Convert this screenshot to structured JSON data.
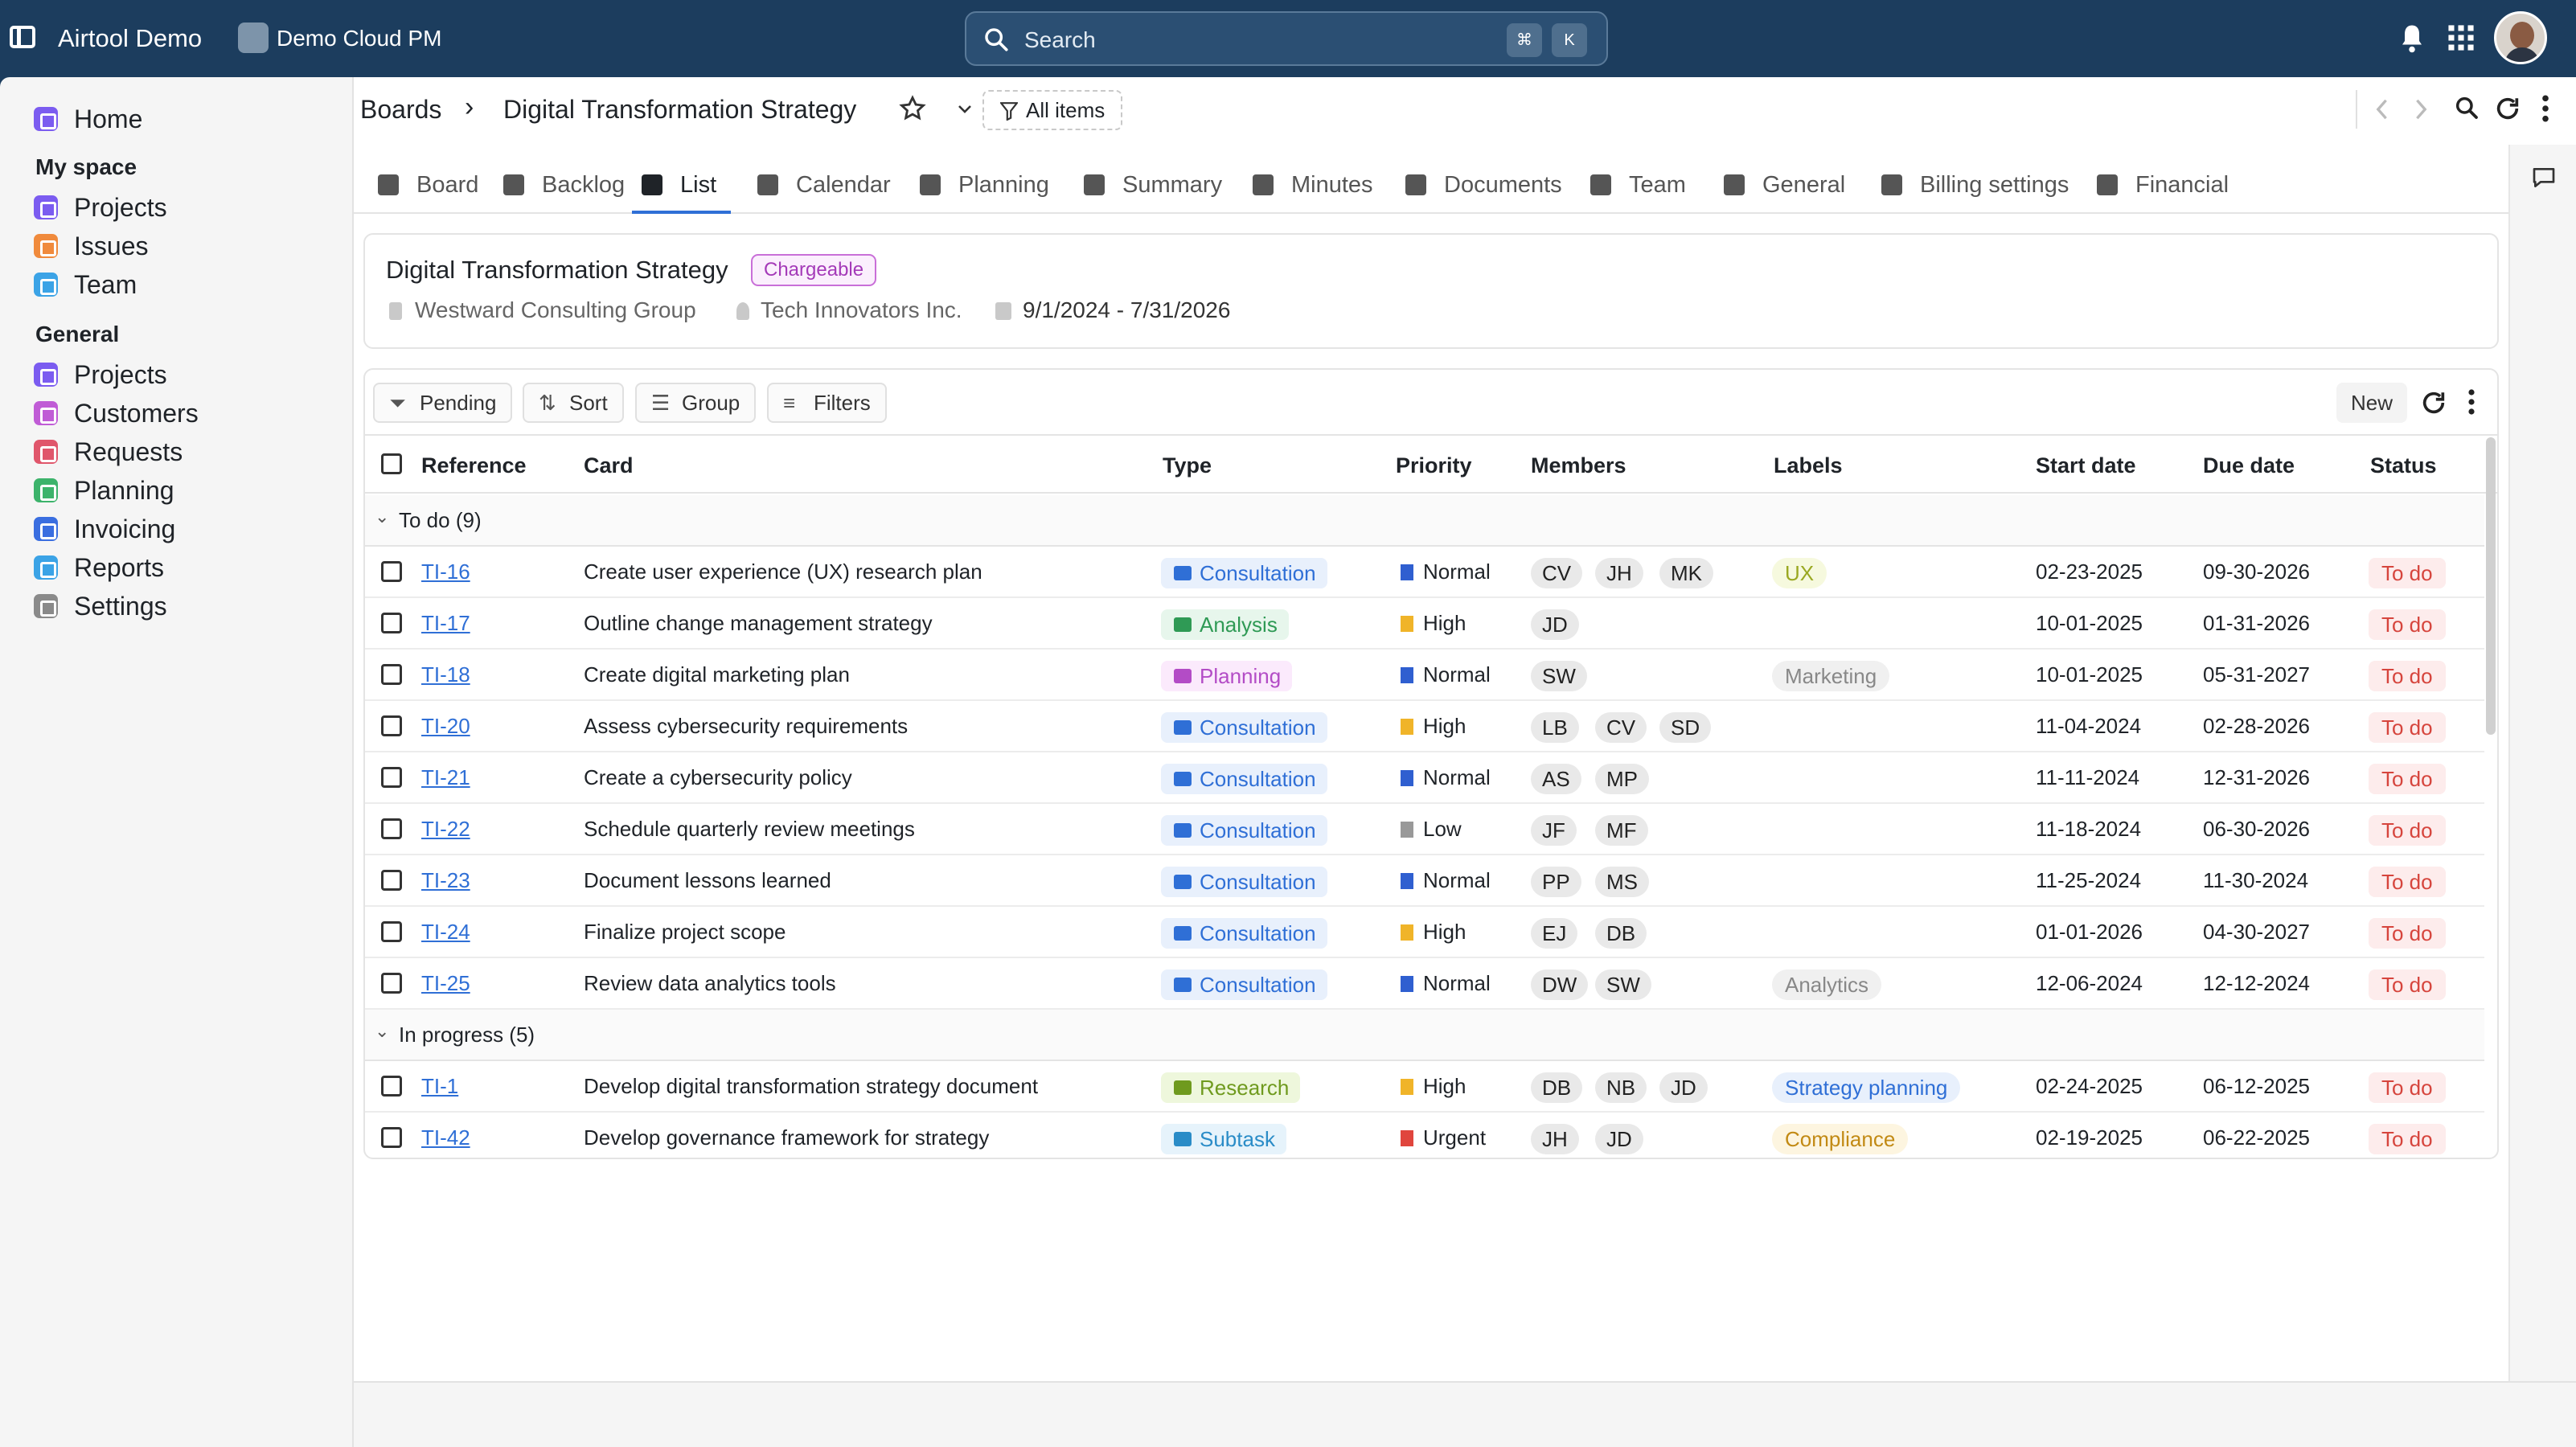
{
  "app": {
    "workspace": "Airtool Demo",
    "project": "Demo Cloud PM",
    "search_placeholder": "Search",
    "kbd1": "⌘",
    "kbd2": "K"
  },
  "sidebar": {
    "home": "Home",
    "my_space_heading": "My space",
    "my_space": [
      {
        "label": "Projects",
        "color": "#7b5cf0"
      },
      {
        "label": "Issues",
        "color": "#f08a3c"
      },
      {
        "label": "Team",
        "color": "#3ba3e6"
      }
    ],
    "general_heading": "General",
    "general": [
      {
        "label": "Projects",
        "color": "#7b5cf0"
      },
      {
        "label": "Customers",
        "color": "#c05cd6"
      },
      {
        "label": "Requests",
        "color": "#e0566b"
      },
      {
        "label": "Planning",
        "color": "#3cb36b"
      },
      {
        "label": "Invoicing",
        "color": "#3a6ee0"
      },
      {
        "label": "Reports",
        "color": "#3ba3e6"
      },
      {
        "label": "Settings",
        "color": "#8a8a8a"
      }
    ]
  },
  "breadcrumb": {
    "root": "Boards",
    "sep": "›",
    "current": "Digital Transformation Strategy",
    "filter": "All items"
  },
  "tabs": [
    "Board",
    "Backlog",
    "List",
    "Calendar",
    "Planning",
    "Summary",
    "Minutes",
    "Documents",
    "Team",
    "General",
    "Billing settings",
    "Financial"
  ],
  "active_tab": "List",
  "project_card": {
    "title": "Digital Transformation Strategy",
    "badge": "Chargeable",
    "client": "Westward Consulting Group",
    "contact": "Tech Innovators Inc.",
    "dates": "9/1/2024 - 7/31/2026"
  },
  "toolbar": {
    "pending": "Pending",
    "sort": "Sort",
    "group": "Group",
    "filters": "Filters",
    "new": "New"
  },
  "columns": [
    "Reference",
    "Card",
    "Type",
    "Priority",
    "Members",
    "Labels",
    "Start date",
    "Due date",
    "Status"
  ],
  "groups": [
    {
      "name": "To do",
      "count": "(9)",
      "rows": [
        {
          "ref": "TI-16",
          "card": "Create user experience (UX) research plan",
          "type": "Consultation",
          "priority": "Normal",
          "members": [
            "CV",
            "JH",
            "MK"
          ],
          "label": "UX",
          "start": "02-23-2025",
          "due": "09-30-2026",
          "status": "To do"
        },
        {
          "ref": "TI-17",
          "card": "Outline change management strategy",
          "type": "Analysis",
          "priority": "High",
          "members": [
            "JD"
          ],
          "label": "",
          "start": "10-01-2025",
          "due": "01-31-2026",
          "status": "To do"
        },
        {
          "ref": "TI-18",
          "card": "Create digital marketing plan",
          "type": "Planning",
          "priority": "Normal",
          "members": [
            "SW"
          ],
          "label": "Marketing",
          "start": "10-01-2025",
          "due": "05-31-2027",
          "status": "To do"
        },
        {
          "ref": "TI-20",
          "card": "Assess cybersecurity requirements",
          "type": "Consultation",
          "priority": "High",
          "members": [
            "LB",
            "CV",
            "SD"
          ],
          "label": "",
          "start": "11-04-2024",
          "due": "02-28-2026",
          "status": "To do"
        },
        {
          "ref": "TI-21",
          "card": "Create a cybersecurity policy",
          "type": "Consultation",
          "priority": "Normal",
          "members": [
            "AS",
            "MP"
          ],
          "label": "",
          "start": "11-11-2024",
          "due": "12-31-2026",
          "status": "To do"
        },
        {
          "ref": "TI-22",
          "card": "Schedule quarterly review meetings",
          "type": "Consultation",
          "priority": "Low",
          "members": [
            "JF",
            "MF"
          ],
          "label": "",
          "start": "11-18-2024",
          "due": "06-30-2026",
          "status": "To do"
        },
        {
          "ref": "TI-23",
          "card": "Document lessons learned",
          "type": "Consultation",
          "priority": "Normal",
          "members": [
            "PP",
            "MS"
          ],
          "label": "",
          "start": "11-25-2024",
          "due": "11-30-2024",
          "status": "To do"
        },
        {
          "ref": "TI-24",
          "card": "Finalize project scope",
          "type": "Consultation",
          "priority": "High",
          "members": [
            "EJ",
            "DB"
          ],
          "label": "",
          "start": "01-01-2026",
          "due": "04-30-2027",
          "status": "To do"
        },
        {
          "ref": "TI-25",
          "card": "Review data analytics tools",
          "type": "Consultation",
          "priority": "Normal",
          "members": [
            "DW",
            "SW"
          ],
          "label": "Analytics",
          "start": "12-06-2024",
          "due": "12-12-2024",
          "status": "To do"
        }
      ]
    },
    {
      "name": "In progress",
      "count": "(5)",
      "rows": [
        {
          "ref": "TI-1",
          "card": "Develop digital transformation strategy document",
          "type": "Research",
          "priority": "High",
          "members": [
            "DB",
            "NB",
            "JD"
          ],
          "label": "Strategy planning",
          "start": "02-24-2025",
          "due": "06-12-2025",
          "status": "To do"
        },
        {
          "ref": "TI-42",
          "card": "Develop governance framework for strategy",
          "type": "Subtask",
          "priority": "Urgent",
          "members": [
            "JH",
            "JD"
          ],
          "label": "Compliance",
          "start": "02-19-2025",
          "due": "06-22-2025",
          "status": "To do"
        }
      ]
    }
  ],
  "type_colors": {
    "Consultation": {
      "bg": "#e8f0fc",
      "fg": "#2f6fd6"
    },
    "Analysis": {
      "bg": "#e7f6ec",
      "fg": "#2f9a55"
    },
    "Planning": {
      "bg": "#fbeafc",
      "fg": "#b34cc6"
    },
    "Research": {
      "bg": "#eef7dc",
      "fg": "#6f9a1e"
    },
    "Subtask": {
      "bg": "#e6f3fb",
      "fg": "#2a8cc7"
    }
  },
  "priority_colors": {
    "Normal": "#2f5fd0",
    "High": "#f0b429",
    "Low": "#999999",
    "Urgent": "#e0453d"
  },
  "label_colors": {
    "UX": {
      "bg": "#f6f9de",
      "fg": "#9aa821"
    },
    "Marketing": {
      "bg": "#f0f0f0",
      "fg": "#888888"
    },
    "Analytics": {
      "bg": "#f0f0f0",
      "fg": "#888888"
    },
    "Strategy planning": {
      "bg": "#e8f0fc",
      "fg": "#2f6fd6"
    },
    "Compliance": {
      "bg": "#fdf5e0",
      "fg": "#c28a14"
    }
  }
}
